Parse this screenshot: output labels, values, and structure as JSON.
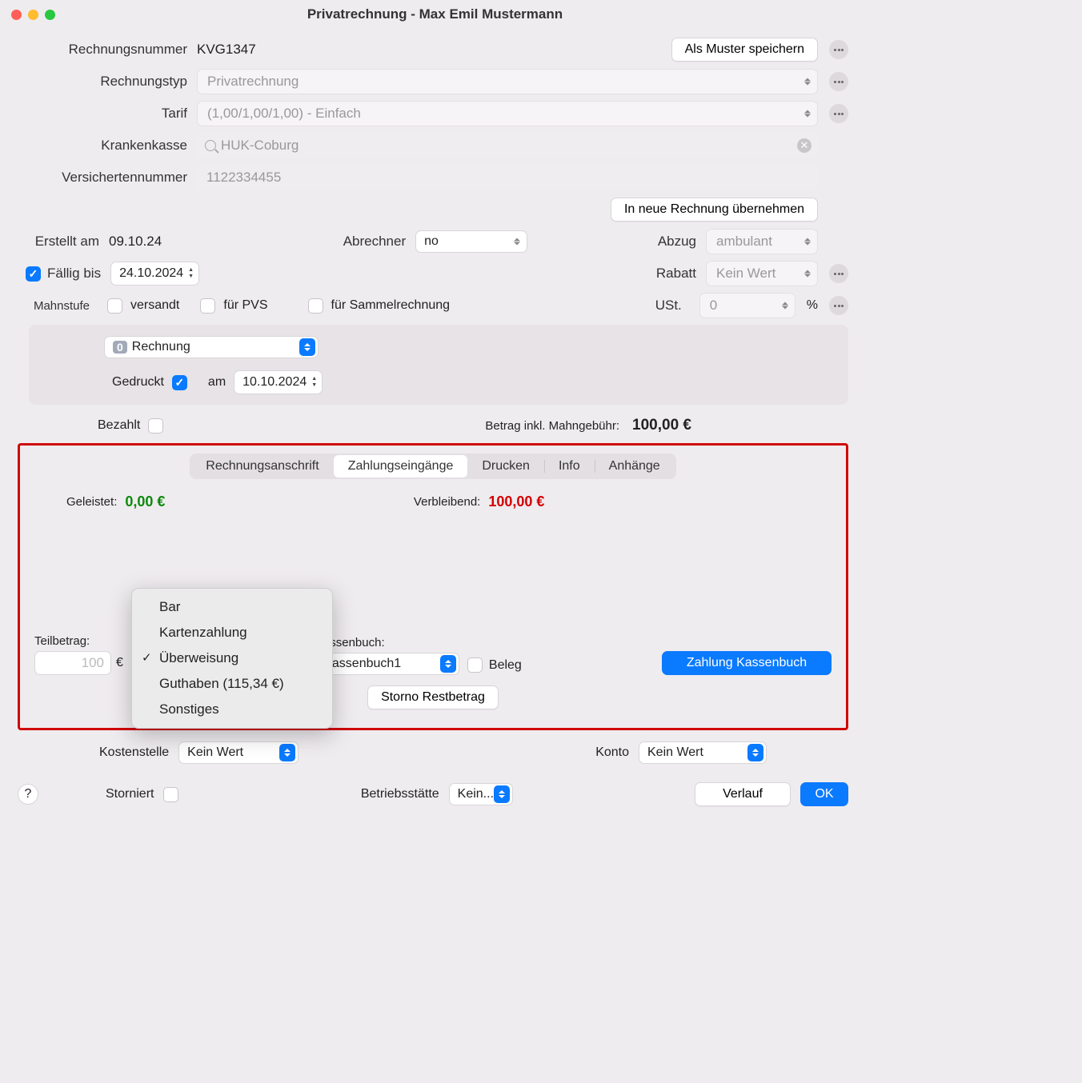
{
  "window_title": "Privatrechnung - Max Emil Mustermann",
  "form": {
    "rechnungsnummer_label": "Rechnungsnummer",
    "rechnungsnummer_value": "KVG1347",
    "als_muster_speichern": "Als Muster speichern",
    "rechnungstyp_label": "Rechnungstyp",
    "rechnungstyp_value": "Privatrechnung",
    "tarif_label": "Tarif",
    "tarif_value": "(1,00/1,00/1,00) - Einfach",
    "krankenkasse_label": "Krankenkasse",
    "krankenkasse_value": "HUK-Coburg",
    "versichertennummer_label": "Versichertennummer",
    "versichertennummer_value": "1122334455",
    "in_neue_rechnung": "In neue Rechnung übernehmen",
    "erstellt_am_label": "Erstellt am",
    "erstellt_am_value": "09.10.24",
    "abrechner_label": "Abrechner",
    "abrechner_value": "no",
    "abzug_label": "Abzug",
    "abzug_value": "ambulant",
    "faellig_bis_label": "Fällig bis",
    "faellig_bis_value": "24.10.2024",
    "rabatt_label": "Rabatt",
    "rabatt_value": "Kein Wert",
    "mahnstufe_label": "Mahnstufe",
    "versandt_label": "versandt",
    "fuer_pvs_label": "für PVS",
    "fuer_sammelrechnung_label": "für Sammelrechnung",
    "ust_label": "USt.",
    "ust_value": "0",
    "percent": "%",
    "rechnung_badge": "0",
    "rechnung_label": "Rechnung",
    "gedruckt_label": "Gedruckt",
    "am_label": "am",
    "gedruckt_date": "10.10.2024",
    "bezahlt_label": "Bezahlt",
    "betrag_label": "Betrag inkl. Mahngebühr:",
    "betrag_value": "100,00 €"
  },
  "tabs": {
    "rechnungsanschrift": "Rechnungsanschrift",
    "zahlungseingaenge": "Zahlungseingänge",
    "drucken": "Drucken",
    "info": "Info",
    "anhaenge": "Anhänge"
  },
  "payments": {
    "geleistet_label": "Geleistet:",
    "geleistet_value": "0,00 €",
    "verbleibend_label": "Verbleibend:",
    "verbleibend_value": "100,00 €",
    "teilbetrag_label": "Teilbetrag:",
    "teilbetrag_value": "100",
    "euro": "€",
    "kassenbuch_label": "assenbuch:",
    "kassenbuch_value": "assenbuch1",
    "beleg_label": "Beleg",
    "zahlung_kassenbuch": "Zahlung Kassenbuch",
    "storno_restbetrag": "Storno Restbetrag"
  },
  "popup": {
    "items": [
      "Bar",
      "Kartenzahlung",
      "Überweisung",
      "Guthaben (115,34 €)",
      "Sonstiges"
    ],
    "selected_index": 2
  },
  "footer": {
    "kostenstelle_label": "Kostenstelle",
    "kostenstelle_value": "Kein Wert",
    "konto_label": "Konto",
    "konto_value": "Kein Wert",
    "storniert_label": "Storniert",
    "betriebsstaette_label": "Betriebsstätte",
    "betriebsstaette_value": "Kein...",
    "verlauf": "Verlauf",
    "ok": "OK",
    "help": "?"
  }
}
